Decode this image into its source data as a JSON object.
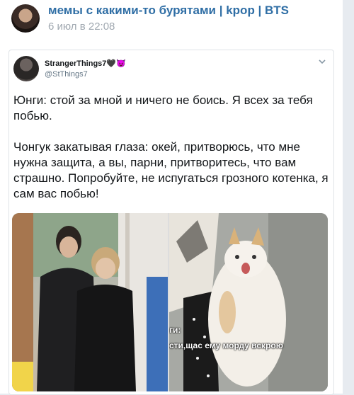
{
  "post": {
    "channel_title": "мемы с какими-то бурятами | kpop | BTS",
    "date": "6 июл в 22:08"
  },
  "tweet": {
    "display_name": "StrangerThings7🖤😈",
    "handle": "@StThings7",
    "paragraphs": [
      "Юнги: стой за мной и ничего не боись. Я всех за тебя побью.",
      "Чонгук закатывая глаза: окей, притворюсь, что мне нужна защита, а вы, парни, притворитесь, что вам страшно. Попробуйте, не испугаться грозного котенка, я сам вас побью!"
    ]
  },
  "media": {
    "caption_line1": "ги:",
    "caption_line2": "сти,щас ему морду вскрою"
  },
  "icons": {
    "menu": "chevron-down-icon"
  }
}
